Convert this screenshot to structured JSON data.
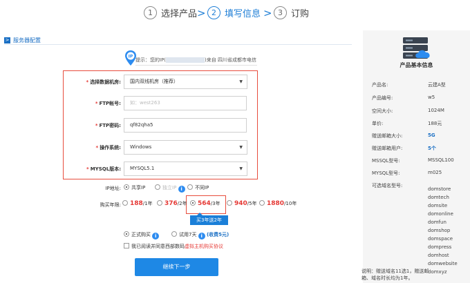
{
  "steps": [
    {
      "num": "1",
      "label": "选择产品"
    },
    {
      "num": "2",
      "label": "填写信息"
    },
    {
      "num": "3",
      "label": "订购"
    }
  ],
  "step_arrow": ">",
  "section": {
    "icon": ">",
    "title": "服务器配置"
  },
  "tip": {
    "icon_text": "IP",
    "prefix": "提示：您的IP(",
    "suffix": ")来自 四川省成都市电信"
  },
  "form": {
    "required_mark": "*",
    "datacenter": {
      "label": "选择数据机房:",
      "value": "国内双线机房（推荐）"
    },
    "ftp_account": {
      "label": "FTP帐号:",
      "placeholder": "如：west263"
    },
    "ftp_password": {
      "label": "FTP密码:",
      "value": "qf82qha5"
    },
    "os": {
      "label": "操作系统:",
      "value": "Windows"
    },
    "mysql": {
      "label": "MYSQL版本:",
      "value": "MYSQL5.1"
    }
  },
  "ip": {
    "label": "IP地址:",
    "options": [
      "共享IP",
      "独立IP",
      "不同IP"
    ]
  },
  "years": {
    "label": "购买年限:",
    "options": [
      {
        "price": "188",
        "unit": "/1年"
      },
      {
        "price": "376",
        "unit": "/2年"
      },
      {
        "price": "564",
        "unit": "/3年"
      },
      {
        "price": "940",
        "unit": "/5年"
      },
      {
        "price": "1880",
        "unit": "/10年"
      }
    ],
    "promo": "买3年送2年"
  },
  "purchase_type": {
    "formal": "正式购买",
    "trial": "试用7天",
    "trial_fee": "(收费5元)"
  },
  "agreement": {
    "text": "我已阅读并同意西部数码",
    "link": "虚拟主机购买协议"
  },
  "submit": "继续下一步",
  "panel": {
    "title": "产品基本信息",
    "rows": [
      {
        "k": "产品名:",
        "v": "云建A型"
      },
      {
        "k": "产品编号:",
        "v": "w5"
      },
      {
        "k": "空间大小:",
        "v": "1024M"
      },
      {
        "k": "单价:",
        "v": "188元"
      },
      {
        "k": "赠送邮箱大小:",
        "v": "5G"
      },
      {
        "k": "赠送邮箱用户:",
        "v": "5个"
      },
      {
        "k": "MSSQL型号:",
        "v": "MSSQL100"
      },
      {
        "k": "MYSQL型号:",
        "v": "m025"
      }
    ],
    "domain_label": "可选域名型号:",
    "domains": [
      "domstore",
      "domtech",
      "domsite",
      "domonline",
      "domfun",
      "domshop",
      "domspace",
      "dompress",
      "domhost",
      "domwebsite",
      "domxyz"
    ],
    "note": "说明：赠送域名11选1，赠送邮箱、域名时长均为1年。"
  },
  "colors": {
    "accent": "#1e88e5",
    "required": "#e53935",
    "panel_bg": "#f5f5f5"
  }
}
